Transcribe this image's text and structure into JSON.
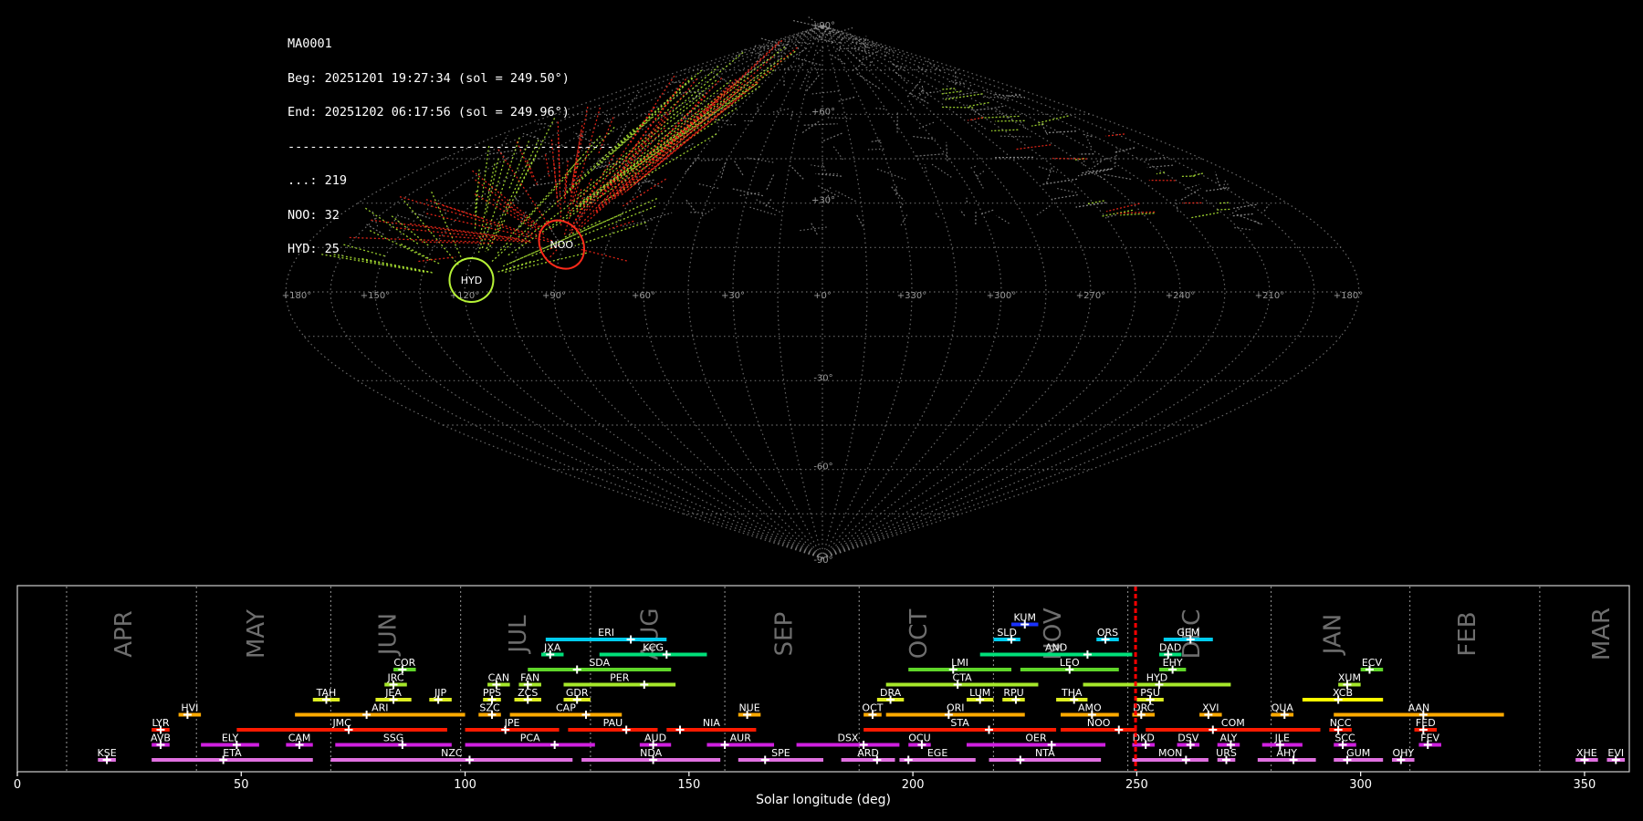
{
  "header": {
    "station": "MA0001",
    "begin": "Beg: 20251201 19:27:34 (sol = 249.50°)",
    "end": "End: 20251202 06:17:56 (sol = 249.96°)",
    "separator": "--------------------------------------------",
    "counts": [
      "...: 219",
      "NOO: 32",
      "HYD: 25"
    ]
  },
  "colors": {
    "background": "#000000",
    "grid": "#8c8c8c",
    "sporadic": "#9a9a9a",
    "NOO": "#ff2a1a",
    "HYD": "#b6f236",
    "current_sol": "#ff0000"
  },
  "sky_map": {
    "projection": "sinusoidal",
    "lon_tick_labels": [
      "+180°",
      "+150°",
      "+120°",
      "+90°",
      "+60°",
      "+30°",
      "+0°",
      "+330°",
      "+300°",
      "+270°",
      "+240°",
      "+210°",
      "+180°"
    ],
    "lat_tick_labels": [
      "+90°",
      "+60°",
      "+30°",
      "-30°",
      "-60°",
      "-90°"
    ],
    "radiants": [
      {
        "code": "NOO",
        "lon": 91,
        "lat": 16
      },
      {
        "code": "HYD",
        "lon": 118,
        "lat": 4
      }
    ]
  },
  "chart_data": {
    "type": "timeline",
    "xlabel": "Solar longitude (deg)",
    "xlim": [
      0,
      360
    ],
    "xticks": [
      0,
      50,
      100,
      150,
      200,
      250,
      300,
      350
    ],
    "current_sol": 249.73,
    "months": [
      {
        "name": "APR",
        "start": 11
      },
      {
        "name": "MAY",
        "start": 40
      },
      {
        "name": "JUN",
        "start": 70
      },
      {
        "name": "JUL",
        "start": 99
      },
      {
        "name": "AUG",
        "start": 128
      },
      {
        "name": "SEP",
        "start": 158
      },
      {
        "name": "OCT",
        "start": 188
      },
      {
        "name": "NOV",
        "start": 218
      },
      {
        "name": "DEC",
        "start": 248
      },
      {
        "name": "JAN",
        "start": 280
      },
      {
        "name": "FEB",
        "start": 311
      },
      {
        "name": "MAR",
        "start": 340
      }
    ],
    "showers": [
      {
        "code": "KUM",
        "row": 9,
        "start": 222,
        "end": 228,
        "peak": 225,
        "color": "#1a32ff"
      },
      {
        "code": "ERI",
        "row": 8,
        "start": 118,
        "end": 145,
        "peak": 137,
        "color": "#00ccee"
      },
      {
        "code": "SLD",
        "row": 8,
        "start": 218,
        "end": 224,
        "peak": 222,
        "color": "#00ccee"
      },
      {
        "code": "ORS",
        "row": 8,
        "start": 241,
        "end": 246,
        "peak": 243,
        "color": "#00ccee"
      },
      {
        "code": "GEM",
        "row": 8,
        "start": 256,
        "end": 267,
        "peak": 262,
        "color": "#00ccee"
      },
      {
        "code": "JXA",
        "row": 7,
        "start": 117,
        "end": 122,
        "peak": 119,
        "color": "#00e07a"
      },
      {
        "code": "KCG",
        "row": 7,
        "start": 130,
        "end": 154,
        "peak": 145,
        "color": "#00e07a"
      },
      {
        "code": "AND",
        "row": 7,
        "start": 215,
        "end": 249,
        "peak": 239,
        "color": "#00e07a"
      },
      {
        "code": "DAD",
        "row": 7,
        "start": 255,
        "end": 260,
        "peak": 257,
        "color": "#00e07a"
      },
      {
        "code": "COR",
        "row": 6,
        "start": 84,
        "end": 89,
        "peak": 86,
        "color": "#5fd629"
      },
      {
        "code": "SDA",
        "row": 6,
        "start": 114,
        "end": 146,
        "peak": 125,
        "color": "#5fd629"
      },
      {
        "code": "LMI",
        "row": 6,
        "start": 199,
        "end": 222,
        "peak": 209,
        "color": "#5fd629"
      },
      {
        "code": "LEO",
        "row": 6,
        "start": 224,
        "end": 246,
        "peak": 235,
        "color": "#5fd629"
      },
      {
        "code": "EHY",
        "row": 6,
        "start": 255,
        "end": 261,
        "peak": 258,
        "color": "#5fd629"
      },
      {
        "code": "ECV",
        "row": 6,
        "start": 300,
        "end": 305,
        "peak": 302,
        "color": "#5fd629"
      },
      {
        "code": "JRC",
        "row": 5,
        "start": 82,
        "end": 87,
        "peak": 84,
        "color": "#a6e82a"
      },
      {
        "code": "CAN",
        "row": 5,
        "start": 105,
        "end": 110,
        "peak": 107,
        "color": "#a6e82a"
      },
      {
        "code": "FAN",
        "row": 5,
        "start": 112,
        "end": 117,
        "peak": 114,
        "color": "#a6e82a"
      },
      {
        "code": "PER",
        "row": 5,
        "start": 122,
        "end": 147,
        "peak": 140,
        "color": "#a6e82a"
      },
      {
        "code": "CTA",
        "row": 5,
        "start": 194,
        "end": 228,
        "peak": 210,
        "color": "#a6e82a"
      },
      {
        "code": "HYD",
        "row": 5,
        "start": 238,
        "end": 271,
        "peak": 255,
        "color": "#a6e82a"
      },
      {
        "code": "XUM",
        "row": 5,
        "start": 295,
        "end": 300,
        "peak": 297,
        "color": "#a6e82a"
      },
      {
        "code": "TAH",
        "row": 4,
        "start": 66,
        "end": 72,
        "peak": 69,
        "color": "#ddee22"
      },
      {
        "code": "JEA",
        "row": 4,
        "start": 80,
        "end": 88,
        "peak": 84,
        "color": "#ddee22"
      },
      {
        "code": "JIP",
        "row": 4,
        "start": 92,
        "end": 97,
        "peak": 94,
        "color": "#ddee22"
      },
      {
        "code": "PPS",
        "row": 4,
        "start": 104,
        "end": 108,
        "peak": 106,
        "color": "#ddee22"
      },
      {
        "code": "ZCS",
        "row": 4,
        "start": 111,
        "end": 117,
        "peak": 114,
        "color": "#ddee22"
      },
      {
        "code": "GDR",
        "row": 4,
        "start": 122,
        "end": 128,
        "peak": 125,
        "color": "#ddee22"
      },
      {
        "code": "DRA",
        "row": 4,
        "start": 192,
        "end": 198,
        "peak": 195,
        "color": "#ddee22"
      },
      {
        "code": "LUM",
        "row": 4,
        "start": 212,
        "end": 218,
        "peak": 215,
        "color": "#ddee22"
      },
      {
        "code": "RPU",
        "row": 4,
        "start": 220,
        "end": 225,
        "peak": 223,
        "color": "#ddee22"
      },
      {
        "code": "THA",
        "row": 4,
        "start": 232,
        "end": 239,
        "peak": 236,
        "color": "#ddee22"
      },
      {
        "code": "PSU",
        "row": 4,
        "start": 250,
        "end": 256,
        "peak": 253,
        "color": "#ddee22"
      },
      {
        "code": "XCB",
        "row": 4,
        "start": 287,
        "end": 305,
        "peak": 295,
        "color": "#ffff00"
      },
      {
        "code": "HVI",
        "row": 3,
        "start": 36,
        "end": 41,
        "peak": 38,
        "color": "#ffaa00"
      },
      {
        "code": "ARI",
        "row": 3,
        "start": 62,
        "end": 100,
        "peak": 78,
        "color": "#ffaa00"
      },
      {
        "code": "SZC",
        "row": 3,
        "start": 103,
        "end": 108,
        "peak": 106,
        "color": "#ffaa00"
      },
      {
        "code": "CAP",
        "row": 3,
        "start": 110,
        "end": 135,
        "peak": 127,
        "color": "#ffaa00"
      },
      {
        "code": "NUE",
        "row": 3,
        "start": 161,
        "end": 166,
        "peak": 163,
        "color": "#ffaa00"
      },
      {
        "code": "OCT",
        "row": 3,
        "start": 189,
        "end": 193,
        "peak": 191,
        "color": "#ffaa00"
      },
      {
        "code": "ORI",
        "row": 3,
        "start": 194,
        "end": 225,
        "peak": 208,
        "color": "#ffaa00"
      },
      {
        "code": "AMO",
        "row": 3,
        "start": 233,
        "end": 246,
        "peak": 240,
        "color": "#ffaa00"
      },
      {
        "code": "DRC",
        "row": 3,
        "start": 249,
        "end": 254,
        "peak": 251,
        "color": "#ffaa00"
      },
      {
        "code": "XVI",
        "row": 3,
        "start": 264,
        "end": 269,
        "peak": 266,
        "color": "#ffaa00"
      },
      {
        "code": "QUA",
        "row": 3,
        "start": 280,
        "end": 285,
        "peak": 283,
        "color": "#ffaa00"
      },
      {
        "code": "AAN",
        "row": 3,
        "start": 294,
        "end": 332,
        "peak": 314,
        "color": "#ffaa00"
      },
      {
        "code": "LYR",
        "row": 2,
        "start": 30,
        "end": 34,
        "peak": 32,
        "color": "#ff1a00"
      },
      {
        "code": "JMC",
        "row": 2,
        "start": 49,
        "end": 96,
        "peak": 74,
        "color": "#ff1a00"
      },
      {
        "code": "JPE",
        "row": 2,
        "start": 100,
        "end": 121,
        "peak": 109,
        "color": "#ff1a00"
      },
      {
        "code": "PAU",
        "row": 2,
        "start": 123,
        "end": 143,
        "peak": 136,
        "color": "#ff1a00"
      },
      {
        "code": "NIA",
        "row": 2,
        "start": 145,
        "end": 165,
        "peak": 148,
        "color": "#ff1a00"
      },
      {
        "code": "STA",
        "row": 2,
        "start": 189,
        "end": 232,
        "peak": 217,
        "color": "#ff1a00"
      },
      {
        "code": "NOO",
        "row": 2,
        "start": 233,
        "end": 250,
        "peak": 246,
        "color": "#ff1a00"
      },
      {
        "code": "COM",
        "row": 2,
        "start": 252,
        "end": 291,
        "peak": 267,
        "color": "#ff1a00"
      },
      {
        "code": "NCC",
        "row": 2,
        "start": 293,
        "end": 298,
        "peak": 295,
        "color": "#ff1a00"
      },
      {
        "code": "FED",
        "row": 2,
        "start": 312,
        "end": 317,
        "peak": 314,
        "color": "#ff1a00"
      },
      {
        "code": "AVB",
        "row": 1,
        "start": 30,
        "end": 34,
        "peak": 32,
        "color": "#d020e0"
      },
      {
        "code": "ELY",
        "row": 1,
        "start": 41,
        "end": 54,
        "peak": 49,
        "color": "#d020e0"
      },
      {
        "code": "CAM",
        "row": 1,
        "start": 60,
        "end": 66,
        "peak": 63,
        "color": "#d020e0"
      },
      {
        "code": "SSG",
        "row": 1,
        "start": 71,
        "end": 97,
        "peak": 86,
        "color": "#d020e0"
      },
      {
        "code": "PCA",
        "row": 1,
        "start": 100,
        "end": 129,
        "peak": 120,
        "color": "#d020e0"
      },
      {
        "code": "AUD",
        "row": 1,
        "start": 139,
        "end": 146,
        "peak": 142,
        "color": "#d020e0"
      },
      {
        "code": "AUR",
        "row": 1,
        "start": 154,
        "end": 169,
        "peak": 158,
        "color": "#d020e0"
      },
      {
        "code": "DSX",
        "row": 1,
        "start": 174,
        "end": 197,
        "peak": 189,
        "color": "#d020e0"
      },
      {
        "code": "OCU",
        "row": 1,
        "start": 199,
        "end": 204,
        "peak": 202,
        "color": "#d020e0"
      },
      {
        "code": "OER",
        "row": 1,
        "start": 212,
        "end": 243,
        "peak": 231,
        "color": "#d020e0"
      },
      {
        "code": "DKD",
        "row": 1,
        "start": 249,
        "end": 254,
        "peak": 252,
        "color": "#d020e0"
      },
      {
        "code": "DSV",
        "row": 1,
        "start": 259,
        "end": 264,
        "peak": 262,
        "color": "#d020e0"
      },
      {
        "code": "ALY",
        "row": 1,
        "start": 268,
        "end": 273,
        "peak": 271,
        "color": "#d020e0"
      },
      {
        "code": "JLE",
        "row": 1,
        "start": 278,
        "end": 287,
        "peak": 282,
        "color": "#d020e0"
      },
      {
        "code": "SCC",
        "row": 1,
        "start": 294,
        "end": 299,
        "peak": 296,
        "color": "#d020e0"
      },
      {
        "code": "FEV",
        "row": 1,
        "start": 313,
        "end": 318,
        "peak": 315,
        "color": "#d020e0"
      },
      {
        "code": "KSE",
        "row": 0,
        "start": 18,
        "end": 22,
        "peak": 20,
        "color": "#e070e0"
      },
      {
        "code": "ETA",
        "row": 0,
        "start": 30,
        "end": 66,
        "peak": 46,
        "color": "#e070e0"
      },
      {
        "code": "NZC",
        "row": 0,
        "start": 70,
        "end": 124,
        "peak": 101,
        "color": "#e070e0"
      },
      {
        "code": "NDA",
        "row": 0,
        "start": 126,
        "end": 157,
        "peak": 142,
        "color": "#e070e0"
      },
      {
        "code": "SPE",
        "row": 0,
        "start": 161,
        "end": 180,
        "peak": 167,
        "color": "#e070e0"
      },
      {
        "code": "ARD",
        "row": 0,
        "start": 184,
        "end": 196,
        "peak": 192,
        "color": "#e070e0"
      },
      {
        "code": "EGE",
        "row": 0,
        "start": 197,
        "end": 214,
        "peak": 199,
        "color": "#e070e0"
      },
      {
        "code": "NTA",
        "row": 0,
        "start": 217,
        "end": 242,
        "peak": 224,
        "color": "#e070e0"
      },
      {
        "code": "MON",
        "row": 0,
        "start": 249,
        "end": 266,
        "peak": 261,
        "color": "#e070e0"
      },
      {
        "code": "URS",
        "row": 0,
        "start": 268,
        "end": 272,
        "peak": 270,
        "color": "#e070e0"
      },
      {
        "code": "AHY",
        "row": 0,
        "start": 277,
        "end": 290,
        "peak": 285,
        "color": "#e070e0"
      },
      {
        "code": "GUM",
        "row": 0,
        "start": 294,
        "end": 305,
        "peak": 297,
        "color": "#e070e0"
      },
      {
        "code": "OHY",
        "row": 0,
        "start": 307,
        "end": 312,
        "peak": 309,
        "color": "#e070e0"
      },
      {
        "code": "XHE",
        "row": 0,
        "start": 348,
        "end": 353,
        "peak": 350,
        "color": "#e070e0"
      },
      {
        "code": "EVI",
        "row": 0,
        "start": 355,
        "end": 359,
        "peak": 357,
        "color": "#e070e0"
      }
    ]
  }
}
